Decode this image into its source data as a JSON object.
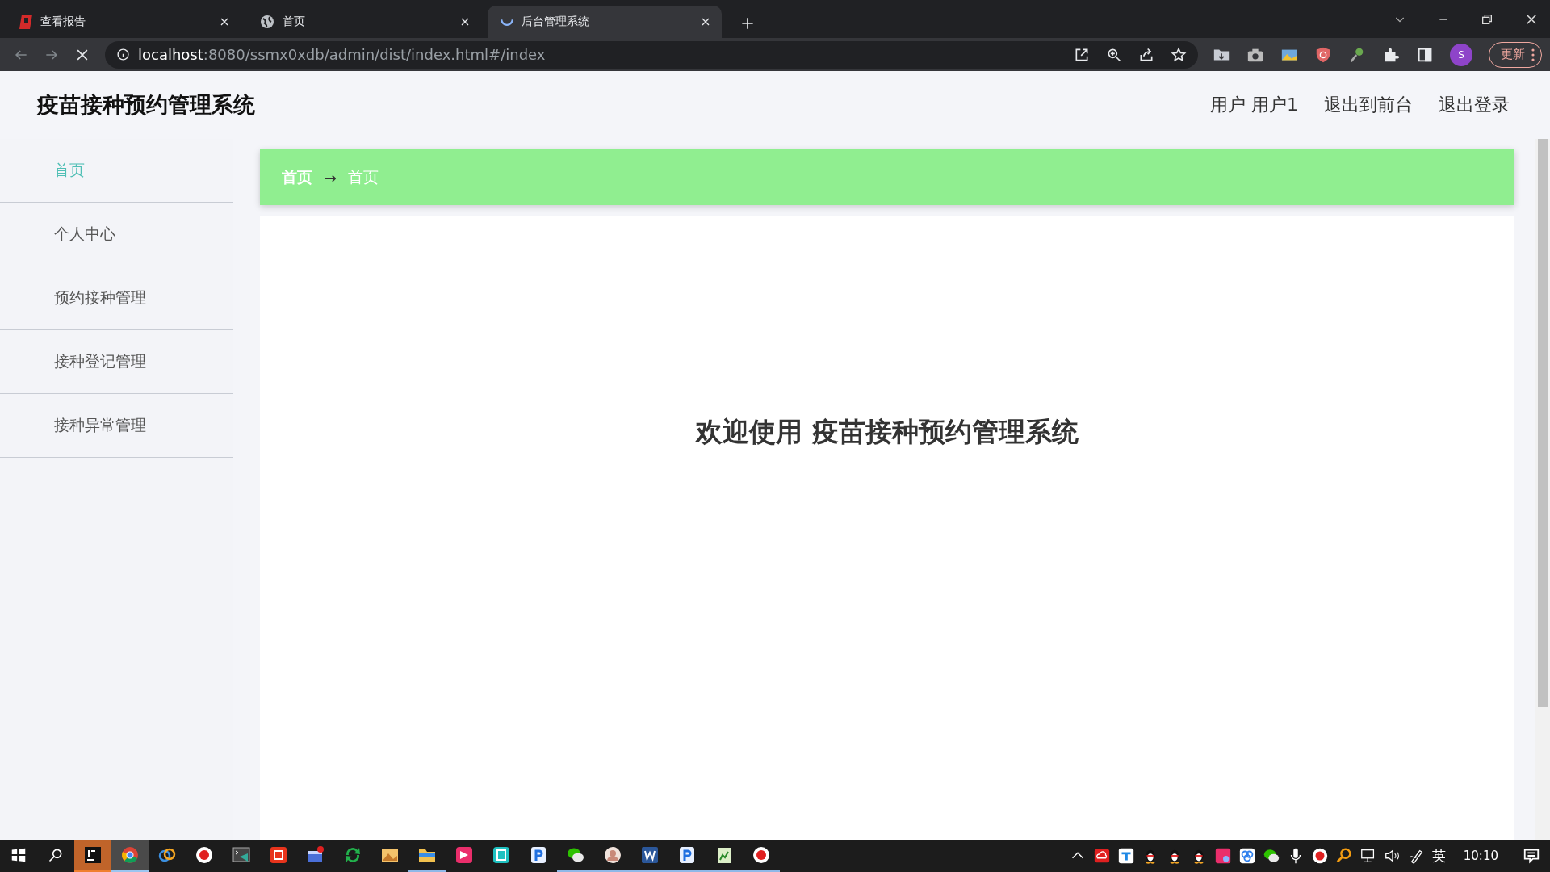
{
  "browser": {
    "tabs": [
      {
        "title": "查看报告",
        "selected": false,
        "kind": "report"
      },
      {
        "title": "首页",
        "selected": false,
        "kind": "globe"
      },
      {
        "title": "后台管理系统",
        "selected": true,
        "kind": "loading"
      }
    ],
    "address": {
      "host": "localhost",
      "path": ":8080/ssmx0xdb/admin/dist/index.html#/index"
    },
    "profile": "S",
    "update_button": "更新"
  },
  "header": {
    "title": "疫苗接种预约管理系统",
    "links": [
      "用户 用户1",
      "退出到前台",
      "退出登录"
    ]
  },
  "sidebar": {
    "items": [
      {
        "label": "首页",
        "selected": true
      },
      {
        "label": "个人中心",
        "selected": false
      },
      {
        "label": "预约接种管理",
        "selected": false
      },
      {
        "label": "接种登记管理",
        "selected": false
      },
      {
        "label": "接种异常管理",
        "selected": false
      }
    ]
  },
  "breadcrumb": {
    "items": [
      "首页",
      "首页"
    ],
    "separator": "→"
  },
  "welcome": "欢迎使用 疫苗接种预约管理系统",
  "taskbar": {
    "apps": [
      {
        "kind": "ide",
        "flashing": true,
        "focused": false,
        "running": true
      },
      {
        "kind": "chrome",
        "flashing": false,
        "focused": true,
        "running": true
      },
      {
        "kind": "rings",
        "flashing": false,
        "focused": false,
        "running": false
      },
      {
        "kind": "record",
        "flashing": false,
        "focused": false,
        "running": false
      },
      {
        "kind": "terminal",
        "flashing": false,
        "focused": false,
        "running": false
      },
      {
        "kind": "radio",
        "flashing": false,
        "focused": false,
        "running": false
      },
      {
        "kind": "window",
        "flashing": false,
        "focused": false,
        "running": false
      },
      {
        "kind": "sync",
        "flashing": false,
        "focused": false,
        "running": false
      },
      {
        "kind": "photo",
        "flashing": false,
        "focused": false,
        "running": false
      },
      {
        "kind": "folder",
        "flashing": false,
        "focused": false,
        "running": true
      },
      {
        "kind": "pink",
        "flashing": false,
        "focused": false,
        "running": false
      },
      {
        "kind": "teal",
        "flashing": false,
        "focused": false,
        "running": false
      },
      {
        "kind": "pdf",
        "flashing": false,
        "focused": false,
        "running": false
      },
      {
        "kind": "chat",
        "flashing": false,
        "focused": false,
        "running": true
      },
      {
        "kind": "avatar",
        "flashing": false,
        "focused": false,
        "running": true
      },
      {
        "kind": "word",
        "flashing": false,
        "focused": false,
        "running": true
      },
      {
        "kind": "pdf",
        "flashing": false,
        "focused": false,
        "running": true
      },
      {
        "kind": "notepad",
        "flashing": false,
        "focused": false,
        "running": true
      },
      {
        "kind": "record",
        "flashing": false,
        "focused": false,
        "running": true
      }
    ],
    "language": "英",
    "clock": "10:10"
  }
}
